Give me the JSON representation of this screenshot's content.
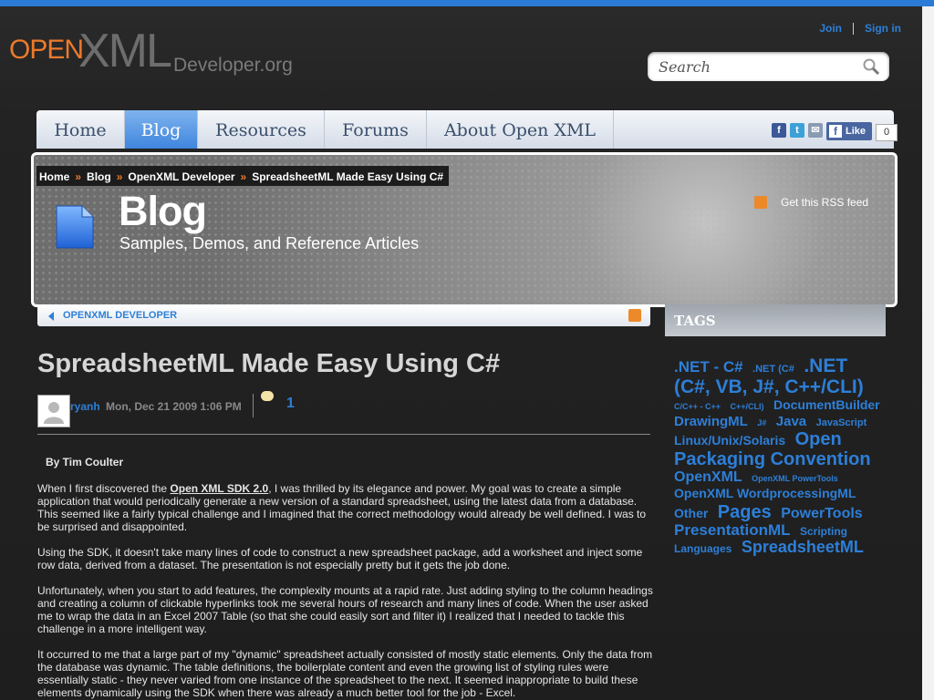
{
  "header": {
    "logo_open": "OPEN",
    "logo_xml": "XML",
    "logo_dev": "Developer.org",
    "join": "Join",
    "signin": "Sign in",
    "search_placeholder": "Search"
  },
  "nav": {
    "items": [
      "Home",
      "Blog",
      "Resources",
      "Forums",
      "About Open XML"
    ],
    "active": "Blog"
  },
  "social": {
    "like_label": "Like",
    "like_count": "0"
  },
  "breadcrumb": [
    "Home",
    "Blog",
    "OpenXML Developer",
    "SpreadsheetML Made Easy Using C#"
  ],
  "banner": {
    "title": "Blog",
    "subtitle": "Samples, Demos, and Reference Articles",
    "rss": "Get this RSS feed"
  },
  "subnav": {
    "label": "OPENXML DEVELOPER"
  },
  "sidebar": {
    "tags_heading": "TAGS",
    "tags": [
      {
        "t": ".NET - C#",
        "s": 17
      },
      {
        "t": ".NET (C#",
        "s": 11
      },
      {
        "t": ".NET (C#, VB, J#, C++/CLI)",
        "s": 21
      },
      {
        "t": "C/C++ - C++",
        "s": 9
      },
      {
        "t": "C++/CLI)",
        "s": 9
      },
      {
        "t": "DocumentBuilder",
        "s": 14
      },
      {
        "t": "DrawingML",
        "s": 15
      },
      {
        "t": "J#",
        "s": 9
      },
      {
        "t": "Java",
        "s": 15
      },
      {
        "t": "JavaScript",
        "s": 11
      },
      {
        "t": "Linux/Unix/Solaris",
        "s": 14
      },
      {
        "t": "Open Packaging Convention",
        "s": 20
      },
      {
        "t": "OpenXML",
        "s": 16
      },
      {
        "t": "OpenXML PowerTools",
        "s": 9
      },
      {
        "t": "OpenXML WordprocessingML",
        "s": 14
      },
      {
        "t": "Other",
        "s": 14
      },
      {
        "t": "Pages",
        "s": 20
      },
      {
        "t": "PowerTools",
        "s": 16
      },
      {
        "t": "PresentationML",
        "s": 17
      },
      {
        "t": "Scripting Languages",
        "s": 12
      },
      {
        "t": "SpreadsheetML",
        "s": 18
      }
    ]
  },
  "article": {
    "title": "SpreadsheetML Made Easy Using C#",
    "author": "ryanh",
    "date": "Mon, Dec 21 2009 1:06 PM",
    "comments": "1",
    "byline": "By Tim Coulter",
    "p1_a": "When I first discovered the ",
    "p1_link": "Open XML SDK 2.0",
    "p1_b": ", I was thrilled by its elegance and power. My goal was to create a simple application that would periodically generate a new version of a standard spreadsheet, using the latest data from a database. This seemed like a fairly typical challenge and I imagined that the correct methodology would already be well defined. I was to be surprised and disappointed.",
    "p2": "Using the SDK, it doesn't take many lines of code to construct a new spreadsheet package, add a worksheet and inject some row data, derived from a dataset. The presentation is not especially pretty but it gets the job done.",
    "p3": "Unfortunately, when you start to add features, the complexity mounts at a rapid rate. Just adding styling to the column headings and creating a column of clickable hyperlinks took me several hours of research and many lines of code. When the user asked me to wrap the data in an Excel 2007 Table (so that she could easily sort and filter it) I realized that I needed to tackle this challenge in a more intelligent way.",
    "p4": "It occurred to me that a large part of my \"dynamic\" spreadsheet actually consisted of mostly static elements. Only the data from the database was dynamic. The table definitions, the boilerplate content and even the growing list of styling rules were essentially static - they never varied from one instance of the spreadsheet to the next. It seemed inappropriate to build these elements dynamically using the SDK when there was already a much better tool for the job - Excel."
  }
}
